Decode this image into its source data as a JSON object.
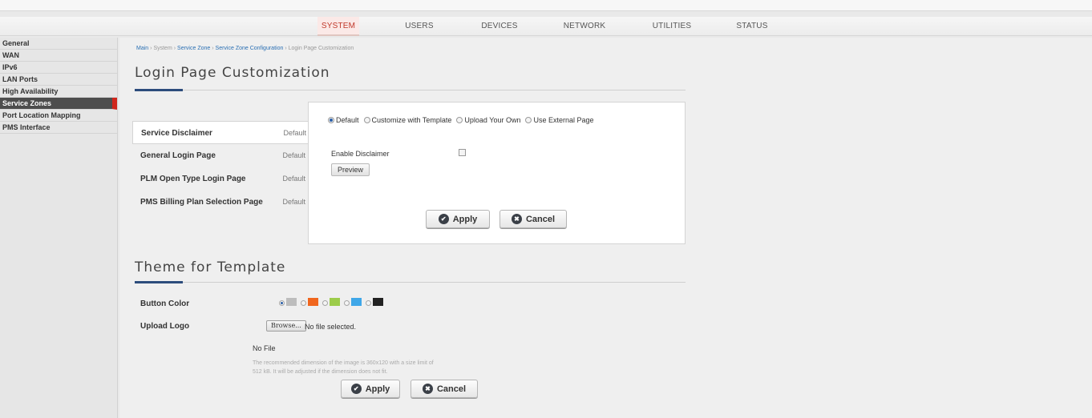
{
  "nav": {
    "items": [
      "SYSTEM",
      "USERS",
      "DEVICES",
      "NETWORK",
      "UTILITIES",
      "STATUS"
    ],
    "active": "SYSTEM"
  },
  "sidebar": {
    "items": [
      "General",
      "WAN",
      "IPv6",
      "LAN Ports",
      "High Availability",
      "Service Zones",
      "Port Location Mapping",
      "PMS Interface"
    ],
    "active": "Service Zones"
  },
  "breadcrumb": {
    "main": "Main",
    "sep": "›",
    "system": "System",
    "service_zone": "Service Zone",
    "config": "Service Zone Configuration",
    "current": "Login Page Customization"
  },
  "login": {
    "title": "Login Page Customization",
    "pages": [
      {
        "label": "Service Disclaimer",
        "state": "Default"
      },
      {
        "label": "General Login Page",
        "state": "Default"
      },
      {
        "label": "PLM Open Type Login Page",
        "state": "Default"
      },
      {
        "label": "PMS Billing Plan Selection Page",
        "state": "Default"
      }
    ],
    "options": [
      "Default",
      "Customize with Template",
      "Upload Your Own",
      "Use External Page"
    ],
    "selected_option": "Default",
    "enable_disclaimer_label": "Enable Disclaimer",
    "enable_disclaimer_checked": false,
    "preview_label": "Preview",
    "apply_label": "Apply",
    "cancel_label": "Cancel"
  },
  "theme": {
    "title": "Theme for Template",
    "button_color_label": "Button Color",
    "colors": [
      "#bdbdbd",
      "#f0661e",
      "#9ccc4a",
      "#3fa7e8",
      "#222222"
    ],
    "selected_color_index": 0,
    "upload_logo_label": "Upload Logo",
    "browse_label": "Browse...",
    "file_status": "No file selected.",
    "current_file": "No File",
    "hint_line1": "The recommended dimension of the image is 360x120 with a size limit of",
    "hint_line2": "512 kB. It will be adjusted if the dimension does not fit.",
    "apply_label": "Apply",
    "cancel_label": "Cancel"
  },
  "icons": {
    "apply": "check-circle-icon",
    "cancel": "x-circle-icon"
  }
}
